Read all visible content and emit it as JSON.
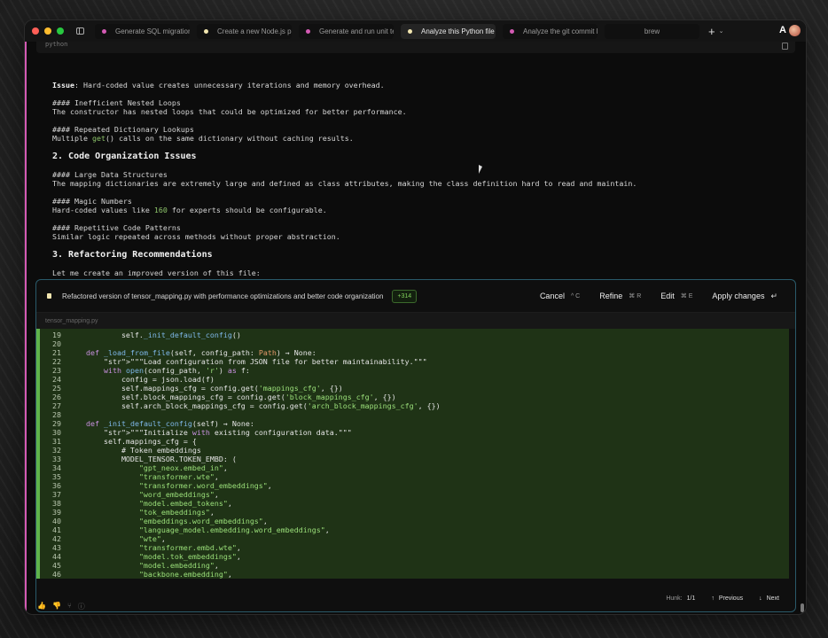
{
  "tabs": [
    {
      "label": "Generate SQL migration",
      "dot": "#d45ab4",
      "active": false
    },
    {
      "label": "Create a new Node.js pr",
      "dot": "#f2e6b0",
      "active": false
    },
    {
      "label": "Generate and run unit te",
      "dot": "#d45ab4",
      "active": false
    },
    {
      "label": "Analyze this Python file",
      "dot": "#f2e6b0",
      "active": true
    },
    {
      "label": "Analyze the git commit h",
      "dot": "#d45ab4",
      "active": false
    },
    {
      "label": "brew",
      "dot": "",
      "active": false
    }
  ],
  "code_lang": "python",
  "prose": {
    "issue_label": "Issue",
    "issue_text": ": Hard-coded value creates unnecessary iterations and memory overhead.",
    "nested_head": "#### Inefficient Nested Loops",
    "nested_text": "The constructor has nested loops that could be optimized for better performance.",
    "dict_head": "#### Repeated Dictionary Lookups",
    "dict_text_a": "Multiple ",
    "dict_text_fn": "get",
    "dict_text_b": "() calls on the same dictionary without caching results.",
    "section2": "2. Code Organization Issues",
    "large_head": "#### Large Data Structures",
    "large_text": "The mapping dictionaries are extremely large and defined as class attributes, making the class definition hard to read and maintain.",
    "magic_head": "#### Magic Numbers",
    "magic_a": "Hard-coded values like ",
    "magic_num": "160",
    "magic_b": " for experts should be configurable.",
    "rep_head": "#### Repetitive Code Patterns",
    "rep_text": "Similar logic repeated across methods without proper abstraction.",
    "section3": "3. Refactoring Recommendations",
    "closing": "Let me create an improved version of this file:"
  },
  "panel": {
    "title": "Refactored version of tensor_mapping.py with performance optimizations and better code organization",
    "badge": "+314",
    "cancel": "Cancel",
    "cancel_keys": "^ C",
    "refine": "Refine",
    "refine_keys": "⌘ R",
    "edit": "Edit",
    "edit_keys": "⌘ E",
    "apply": "Apply changes",
    "file_tab": "tensor_mapping.py",
    "hunk_label": "Hunk:",
    "hunk_value": "1/1",
    "previous": "Previous",
    "next": "Next"
  },
  "code_lines": [
    {
      "n": "19",
      "t": "            self._init_default_config()"
    },
    {
      "n": "20",
      "t": ""
    },
    {
      "n": "21",
      "t": "    def _load_from_file(self, config_path: Path) → None:"
    },
    {
      "n": "22",
      "t": "        \"\"\"Load configuration from JSON file for better maintainability.\"\"\""
    },
    {
      "n": "23",
      "t": "        with open(config_path, 'r') as f:"
    },
    {
      "n": "24",
      "t": "            config = json.load(f)"
    },
    {
      "n": "25",
      "t": "            self.mappings_cfg = config.get('mappings_cfg', {})"
    },
    {
      "n": "26",
      "t": "            self.block_mappings_cfg = config.get('block_mappings_cfg', {})"
    },
    {
      "n": "27",
      "t": "            self.arch_block_mappings_cfg = config.get('arch_block_mappings_cfg', {})"
    },
    {
      "n": "28",
      "t": ""
    },
    {
      "n": "29",
      "t": "    def _init_default_config(self) → None:"
    },
    {
      "n": "30",
      "t": "        \"\"\"Initialize with existing configuration data.\"\"\""
    },
    {
      "n": "31",
      "t": "        self.mappings_cfg = {"
    },
    {
      "n": "32",
      "t": "            # Token embeddings"
    },
    {
      "n": "33",
      "t": "            MODEL_TENSOR.TOKEN_EMBD: ("
    },
    {
      "n": "34",
      "t": "                \"gpt_neox.embed_in\","
    },
    {
      "n": "35",
      "t": "                \"transformer.wte\","
    },
    {
      "n": "36",
      "t": "                \"transformer.word_embeddings\","
    },
    {
      "n": "37",
      "t": "                \"word_embeddings\","
    },
    {
      "n": "38",
      "t": "                \"model.embed_tokens\","
    },
    {
      "n": "39",
      "t": "                \"tok_embeddings\","
    },
    {
      "n": "40",
      "t": "                \"embeddings.word_embeddings\","
    },
    {
      "n": "41",
      "t": "                \"language_model.embedding.word_embeddings\","
    },
    {
      "n": "42",
      "t": "                \"wte\","
    },
    {
      "n": "43",
      "t": "                \"transformer.embd.wte\","
    },
    {
      "n": "44",
      "t": "                \"model.tok_embeddings\","
    },
    {
      "n": "45",
      "t": "                \"model.embedding\","
    },
    {
      "n": "46",
      "t": "                \"backbone.embedding\","
    }
  ],
  "colors": {
    "accent": "#d45ab4",
    "diff_bg": "#1f3316",
    "diff_bar": "#5fb34a",
    "panel_border": "#2a5a6a"
  }
}
